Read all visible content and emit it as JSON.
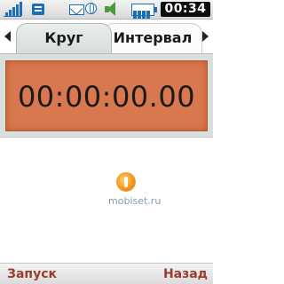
{
  "status_bar": {
    "time": "00:34",
    "icons": [
      "signal-icon",
      "sim-icon",
      "message-icon",
      "globe-icon",
      "speaker-icon",
      "battery-icon"
    ],
    "accent_color": "#1b6fb8"
  },
  "tabs": [
    {
      "label": "Круг",
      "active": true
    },
    {
      "label": "Интервал",
      "active": false
    }
  ],
  "timer": {
    "value": "00:00:00.00",
    "background_color": "#d9784e"
  },
  "watermark": {
    "text": "mobiset.ru"
  },
  "softkeys": {
    "left": "Запуск",
    "right": "Назад",
    "color": "#9a3d2e"
  }
}
